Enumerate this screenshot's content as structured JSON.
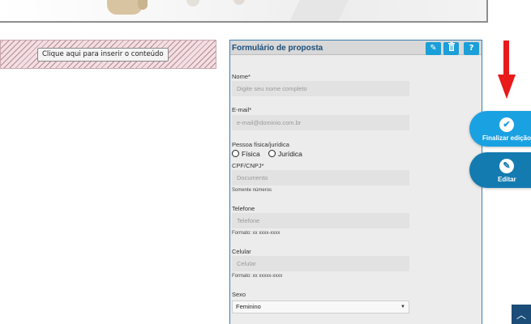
{
  "hatch_area": {
    "insert_button": "Clique aqui para inserir o conteúdo"
  },
  "form": {
    "title": "Formulário de proposta",
    "header_icons": [
      "pencil-icon",
      "trash-icon",
      "help-icon"
    ],
    "help_label": "?",
    "fields": {
      "nome": {
        "label": "Nome*",
        "placeholder": "Digite seu nome completo"
      },
      "email": {
        "label": "E-mail*",
        "placeholder": "e-mail@dominio.com.br"
      },
      "pessoa": {
        "label": "Pessoa física/jurídica",
        "options": [
          "Física",
          "Jurídica"
        ]
      },
      "cpf": {
        "label": "CPF/CNPJ*",
        "placeholder": "Documento",
        "hint": "Somente números"
      },
      "telefone": {
        "label": "Telefone",
        "placeholder": "Telefone",
        "hint": "Formato: xx xxxx-xxxx"
      },
      "celular": {
        "label": "Celular",
        "placeholder": "Celular",
        "hint": "Formato: xx xxxxx-xxxx"
      },
      "sexo": {
        "label": "Sexo",
        "selected": "Feminino"
      }
    }
  },
  "actions": {
    "finish_label": "Finalizar edição",
    "edit_label": "Editar"
  },
  "colors": {
    "accent": "#1aa1e2",
    "accent_dark": "#147bb0",
    "arrow": "#e81a1a",
    "panel_border": "#3a7fb8"
  }
}
